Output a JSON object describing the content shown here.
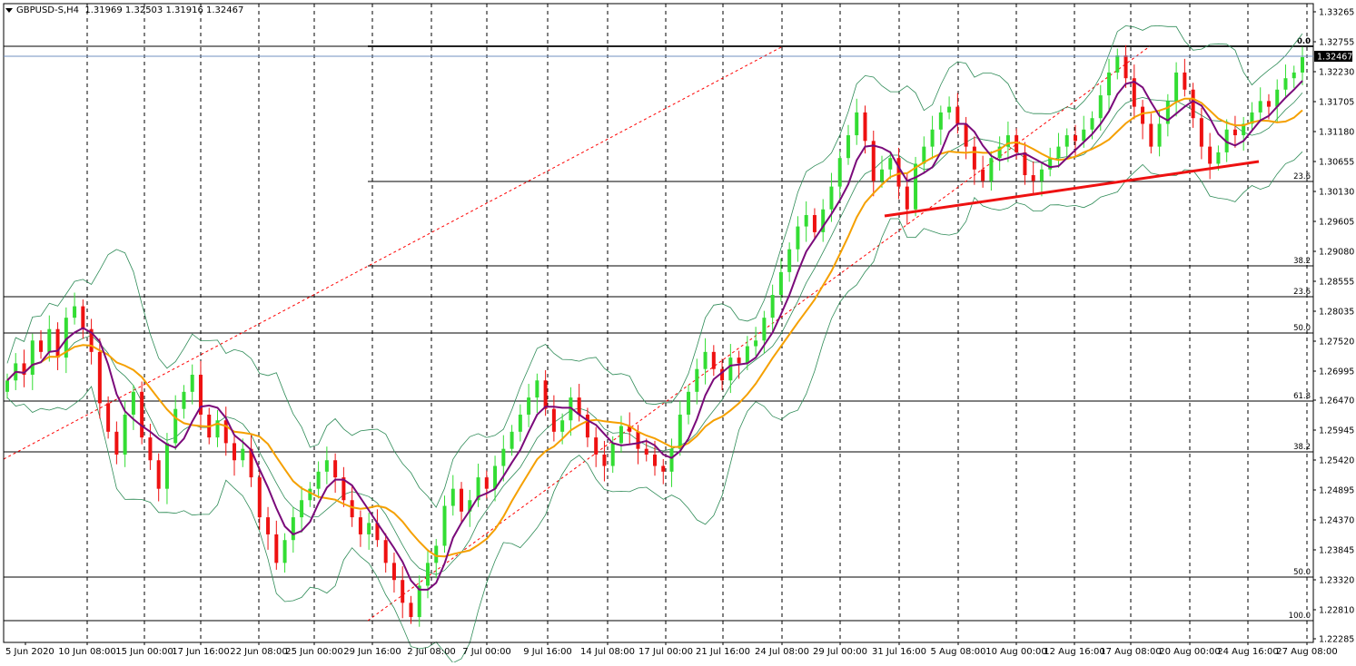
{
  "symbol_header": {
    "symbol": "GBPUSD-S,H4",
    "ohlc": "1.31969 1.32503 1.31916 1.32467"
  },
  "colors": {
    "background": "#ffffff",
    "bull_candle": "#33dd33",
    "bear_candle": "#ee1111",
    "ma_fast": "#7a0a7a",
    "ma_slow": "#f5a000",
    "bollinger": "#2e8b57",
    "fib_lines": "#000000",
    "fib_diagonal": "#ff0000",
    "trendline": "#ee1111",
    "price_tag": "#000000",
    "price_line": "#7090c0"
  },
  "current_price": "1.32467",
  "chart_data": {
    "type": "candlestick",
    "instrument": "GBPUSD-S",
    "timeframe": "H4",
    "ylim": [
      1.22285,
      1.33265
    ],
    "y_ticks": [
      "1.33265",
      "1.32755",
      "1.32230",
      "1.31705",
      "1.31180",
      "1.30655",
      "1.30130",
      "1.29605",
      "1.29080",
      "1.28555",
      "1.28035",
      "1.27520",
      "1.26995",
      "1.26470",
      "1.25945",
      "1.25420",
      "1.24895",
      "1.24370",
      "1.23845",
      "1.23320",
      "1.22810",
      "1.22285"
    ],
    "x_ticks": [
      "5 Jun 2020",
      "10 Jun 08:00",
      "15 Jun 00:00",
      "17 Jun 16:00",
      "22 Jun 08:00",
      "25 Jun 00:00",
      "29 Jun 16:00",
      "2 Jul 08:00",
      "7 Jul 00:00",
      "9 Jul 16:00",
      "14 Jul 08:00",
      "17 Jul 00:00",
      "21 Jul 16:00",
      "24 Jul 08:00",
      "29 Jul 00:00",
      "31 Jul 16:00",
      "5 Aug 08:00",
      "10 Aug 00:00",
      "12 Aug 16:00",
      "17 Aug 08:00",
      "20 Aug 00:00",
      "24 Aug 16:00",
      "27 Aug 08:00"
    ],
    "fib_retracement_1": {
      "levels": [
        {
          "label": "38.2",
          "price": 1.2549
        },
        {
          "label": "50.0",
          "price": 1.2336
        },
        {
          "label": "100.0",
          "price": 1.2262
        },
        {
          "label": "61.8",
          "price": 1.2646
        },
        {
          "label": "50.0",
          "price": 1.2771
        },
        {
          "label": "23.6",
          "price": 1.2821
        }
      ]
    },
    "fib_retracement_2": {
      "levels": [
        {
          "label": "0.0",
          "price": 1.3262
        },
        {
          "label": "23.6",
          "price": 1.3032
        },
        {
          "label": "38.2",
          "price": 1.2876
        }
      ]
    },
    "trendline": {
      "from": {
        "date": "31 Jul 16:00",
        "price": 1.297
      },
      "to": {
        "date": "24 Aug 16:00",
        "price": 1.3065
      }
    },
    "closes": [
      1.268,
      1.271,
      1.269,
      1.275,
      1.273,
      1.277,
      1.272,
      1.279,
      1.281,
      1.277,
      1.273,
      1.264,
      1.259,
      1.255,
      1.262,
      1.266,
      1.258,
      1.254,
      1.249,
      1.257,
      1.263,
      1.266,
      1.269,
      1.262,
      1.258,
      1.261,
      1.257,
      1.254,
      1.256,
      1.251,
      1.244,
      1.241,
      1.236,
      1.24,
      1.244,
      1.247,
      1.249,
      1.252,
      1.254,
      1.251,
      1.247,
      1.244,
      1.241,
      1.243,
      1.24,
      1.236,
      1.233,
      1.229,
      1.2265,
      1.232,
      1.236,
      1.239,
      1.246,
      1.249,
      1.245,
      1.247,
      1.251,
      1.249,
      1.253,
      1.256,
      1.259,
      1.262,
      1.265,
      1.268,
      1.263,
      1.259,
      1.261,
      1.265,
      1.262,
      1.258,
      1.255,
      1.253,
      1.257,
      1.26,
      1.259,
      1.256,
      1.255,
      1.253,
      1.252,
      1.256,
      1.262,
      1.266,
      1.27,
      1.273,
      1.27,
      1.268,
      1.272,
      1.271,
      1.274,
      1.275,
      1.279,
      1.283,
      1.287,
      1.291,
      1.295,
      1.297,
      1.294,
      1.298,
      1.302,
      1.307,
      1.311,
      1.315,
      1.31,
      1.303,
      1.305,
      1.307,
      1.302,
      1.298,
      1.306,
      1.309,
      1.312,
      1.315,
      1.316,
      1.313,
      1.309,
      1.305,
      1.303,
      1.307,
      1.309,
      1.311,
      1.308,
      1.304,
      1.303,
      1.305,
      1.307,
      1.309,
      1.311,
      1.31,
      1.312,
      1.314,
      1.318,
      1.322,
      1.325,
      1.321,
      1.316,
      1.313,
      1.309,
      1.313,
      1.317,
      1.322,
      1.319,
      1.314,
      1.309,
      1.306,
      1.308,
      1.312,
      1.311,
      1.313,
      1.315,
      1.317,
      1.316,
      1.319,
      1.321,
      1.322,
      1.3247
    ]
  }
}
